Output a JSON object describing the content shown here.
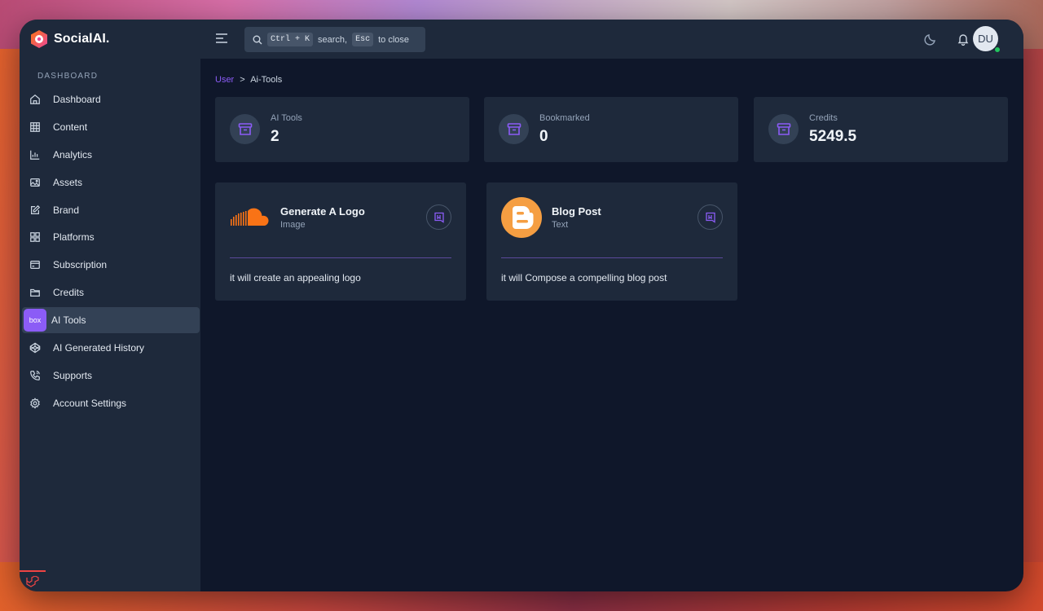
{
  "app": {
    "name": "SocialAI."
  },
  "sidebar": {
    "section": "DASHBOARD",
    "items": [
      {
        "label": "Dashboard",
        "icon": "home-icon"
      },
      {
        "label": "Content",
        "icon": "grid-icon"
      },
      {
        "label": "Analytics",
        "icon": "bar-chart-icon"
      },
      {
        "label": "Assets",
        "icon": "image-icon"
      },
      {
        "label": "Brand",
        "icon": "edit-icon"
      },
      {
        "label": "Platforms",
        "icon": "apps-icon"
      },
      {
        "label": "Subscription",
        "icon": "card-icon"
      },
      {
        "label": "Credits",
        "icon": "folder-icon"
      },
      {
        "label": "AI Tools",
        "icon": "box-icon",
        "icon_text": "box",
        "active": true
      },
      {
        "label": "AI Generated History",
        "icon": "codepen-icon"
      },
      {
        "label": "Supports",
        "icon": "phone-icon"
      },
      {
        "label": "Account Settings",
        "icon": "settings-icon"
      }
    ]
  },
  "topbar": {
    "search": {
      "kbd1": "Ctrl + K",
      "text1": "search,",
      "kbd2": "Esc",
      "text2": "to close"
    },
    "avatar": "DU"
  },
  "breadcrumb": {
    "link": "User",
    "separator": ">",
    "current": "Ai-Tools"
  },
  "stats": [
    {
      "label": "AI Tools",
      "value": "2"
    },
    {
      "label": "Bookmarked",
      "value": "0"
    },
    {
      "label": "Credits",
      "value": "5249.5"
    }
  ],
  "tools": [
    {
      "title": "Generate A Logo",
      "type": "Image",
      "description": "it will create an appealing logo",
      "icon": "soundcloud-logo-icon"
    },
    {
      "title": "Blog Post",
      "type": "Text",
      "description": "it will Compose a compelling blog post",
      "icon": "blogger-logo-icon"
    }
  ],
  "colors": {
    "accent": "#8b5cf6",
    "panel": "#1e293b",
    "background": "#0f172a"
  }
}
